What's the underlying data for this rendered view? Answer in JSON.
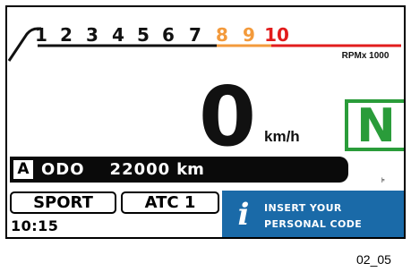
{
  "tachometer": {
    "labels": [
      "1",
      "2",
      "3",
      "4",
      "5",
      "6",
      "7",
      "8",
      "9",
      "10"
    ],
    "unit_label": "RPMx 1000",
    "colors": {
      "normal": "#111111",
      "warning": "#f39a3b",
      "redline": "#e21c1c"
    }
  },
  "speed": {
    "value": "0",
    "unit": "km/h"
  },
  "gear": {
    "value": "N",
    "color": "#2a9c3a"
  },
  "odometer": {
    "mode": "A",
    "label": "ODO",
    "value": "22000",
    "unit": "km"
  },
  "ride_mode": {
    "label": "SPORT"
  },
  "traction_control": {
    "label": "ATC 1"
  },
  "clock": {
    "time": "10:15"
  },
  "message": {
    "icon": "info-icon",
    "line1": "INSERT YOUR",
    "line2": "PERSONAL CODE",
    "background": "#1a6aa8"
  },
  "figure_caption": "02_05"
}
